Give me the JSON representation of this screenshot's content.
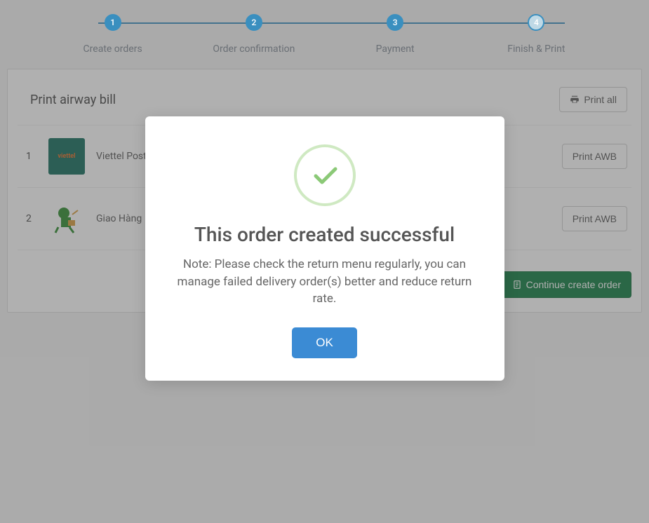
{
  "stepper": {
    "steps": [
      {
        "num": "1",
        "label": "Create orders"
      },
      {
        "num": "2",
        "label": "Order confirmation"
      },
      {
        "num": "3",
        "label": "Payment"
      },
      {
        "num": "4",
        "label": "Finish & Print"
      }
    ]
  },
  "panel": {
    "title": "Print airway bill",
    "print_all_label": "Print all",
    "continue_label": "Continue create order"
  },
  "rows": [
    {
      "num": "1",
      "carrier": "Viettel Post",
      "action": "Print AWB"
    },
    {
      "num": "2",
      "carrier": "Giao Hàng",
      "action": "Print AWB"
    }
  ],
  "modal": {
    "title": "This order created successful",
    "note": "Note: Please check the return menu regularly, you can manage failed delivery order(s) better and reduce return rate.",
    "ok_label": "OK"
  }
}
